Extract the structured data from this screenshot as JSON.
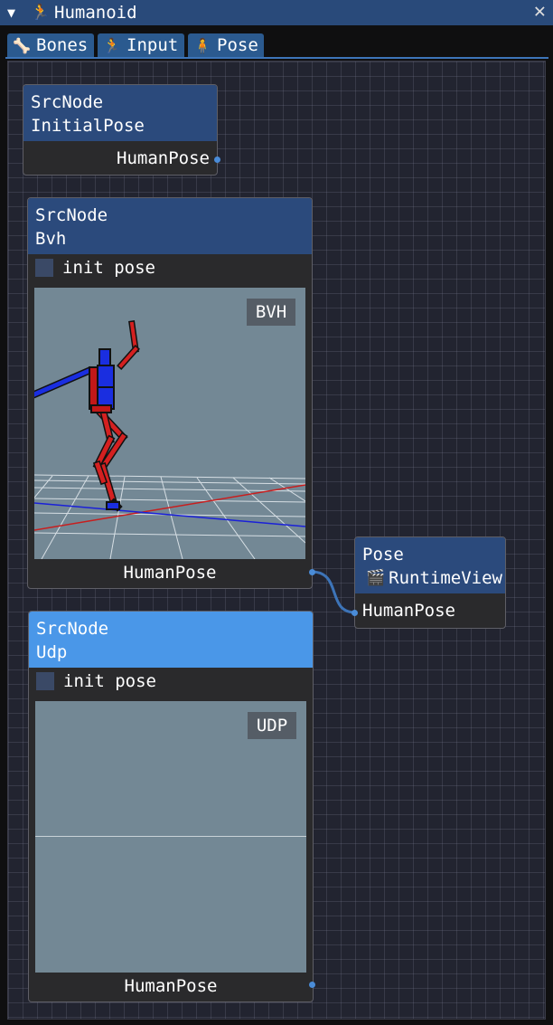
{
  "window": {
    "title": "Humanoid",
    "collapse_icon": "triangle-down",
    "app_icon": "running-figure-icon",
    "close_icon": "close-icon"
  },
  "tabs": [
    {
      "label": "Bones",
      "icon": "bone-icon"
    },
    {
      "label": "Input",
      "icon": "running-figure-icon"
    },
    {
      "label": "Pose",
      "icon": "person-icon"
    }
  ],
  "nodes": {
    "initial": {
      "type": "SrcNode",
      "name": "InitialPose",
      "output": "HumanPose"
    },
    "bvh": {
      "type": "SrcNode",
      "name": "Bvh",
      "checkbox": "init pose",
      "checked": false,
      "view_label": "BVH",
      "output": "HumanPose"
    },
    "udp": {
      "type": "SrcNode",
      "name": "Udp",
      "checkbox": "init pose",
      "checked": false,
      "view_label": "UDP",
      "output": "HumanPose"
    },
    "pose": {
      "type": "Pose",
      "name": "RuntimeView",
      "name_icon": "clapperboard-icon",
      "input": "HumanPose"
    }
  },
  "colors": {
    "accent": "#4a97e8",
    "node_header": "#2b4a7c",
    "link": "#3d74b8",
    "skeleton_red": "#d42020",
    "skeleton_blue": "#1a2ee0"
  }
}
